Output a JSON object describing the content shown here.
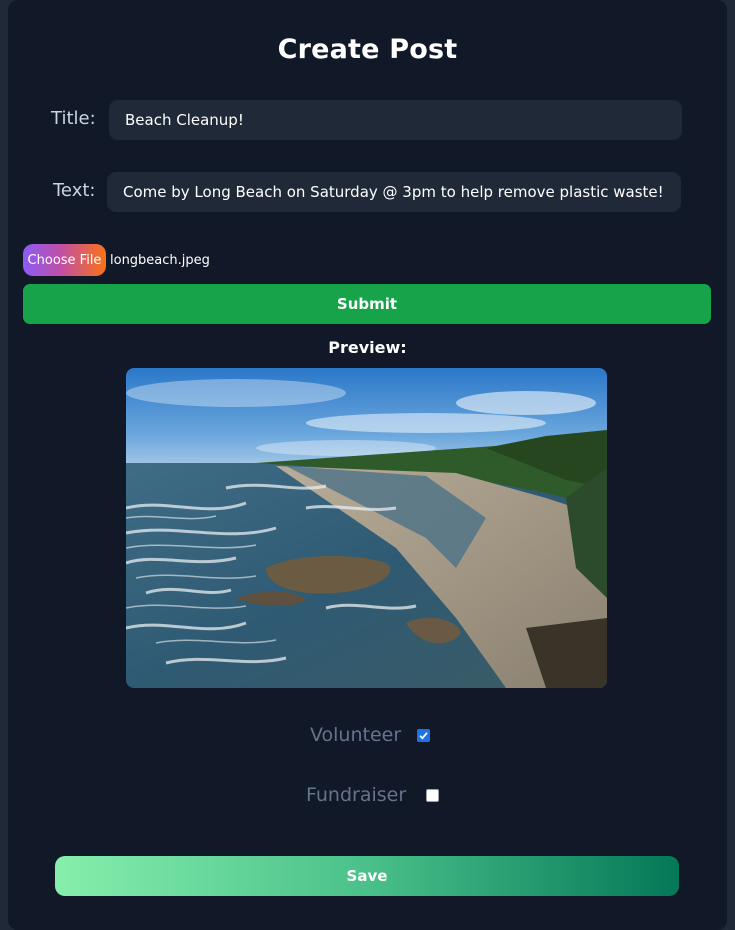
{
  "header": {
    "title": "Create Post"
  },
  "form": {
    "title_label": "Title:",
    "title_value": "Beach Cleanup!",
    "text_label": "Text:",
    "text_value": "Come by Long Beach on Saturday @ 3pm to help remove plastic waste!",
    "file_button_label": "Choose File",
    "file_name": "longbeach.jpeg",
    "submit_label": "Submit"
  },
  "preview": {
    "label": "Preview:",
    "image": "beach-coastline-photo"
  },
  "options": {
    "volunteer": {
      "label": "Volunteer",
      "checked": true
    },
    "fundraiser": {
      "label": "Fundraiser",
      "checked": false
    }
  },
  "save_label": "Save",
  "colors": {
    "background": "#111827",
    "input_bg": "#1f2937",
    "submit": "#16a34a",
    "checkbox_checked": "#1d72e8"
  }
}
